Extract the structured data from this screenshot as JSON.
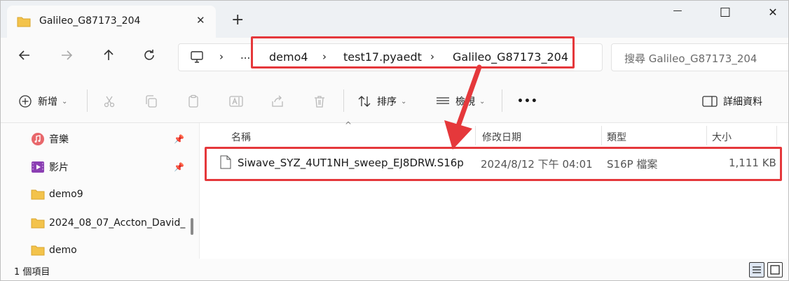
{
  "window": {
    "tab_title": "Galileo_G87173_204",
    "tab_close_glyph": "✕",
    "new_tab_glyph": "+",
    "controls": {
      "minimize": "—",
      "maximize": "☐",
      "close": "✕"
    }
  },
  "address_bar": {
    "overflow": "...",
    "separator": "›",
    "crumbs": [
      "demo4",
      "test17.pyaedt",
      "Galileo_G87173_204"
    ],
    "search_placeholder": "搜尋 Galileo_G87173_204"
  },
  "toolbar": {
    "new_label": "新增",
    "sort_label": "排序",
    "view_label": "檢視",
    "more_label": "•••",
    "details_label": "詳細資料"
  },
  "sidebar": {
    "items": [
      {
        "label": "音樂",
        "icon": "music-icon",
        "pinned": true
      },
      {
        "label": "影片",
        "icon": "video-icon",
        "pinned": true
      },
      {
        "label": "demo9",
        "icon": "folder-icon",
        "pinned": false
      },
      {
        "label": "2024_08_07_Accton_David_",
        "icon": "folder-icon",
        "pinned": false
      },
      {
        "label": "demo",
        "icon": "folder-icon",
        "pinned": false
      }
    ]
  },
  "file_list": {
    "columns": {
      "name": "名稱",
      "modified": "修改日期",
      "type": "類型",
      "size": "大小"
    },
    "rows": [
      {
        "name": "Siwave_SYZ_4UT1NH_sweep_EJ8DRW.S16p",
        "modified": "2024/8/12 下午 04:01",
        "type": "S16P 檔案",
        "size": "1,111 KB"
      }
    ]
  },
  "status_bar": {
    "item_count": "1 個項目"
  },
  "colors": {
    "highlight": "#e5383b",
    "folder": "#f3c34b",
    "accent": "#1e66c9"
  }
}
